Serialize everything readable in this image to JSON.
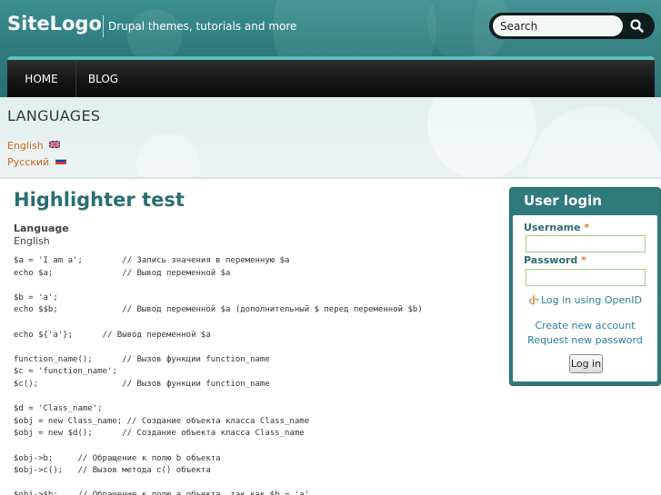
{
  "site": {
    "logo": "SiteLogo",
    "slogan": "Drupal themes, tutorials and more"
  },
  "search": {
    "placeholder": "Search",
    "icon": "search-icon"
  },
  "nav": {
    "items": [
      {
        "label": "HOME"
      },
      {
        "label": "BLOG"
      }
    ]
  },
  "languages": {
    "title": "LANGUAGES",
    "items": [
      {
        "label": "English",
        "flag": "uk-flag-icon"
      },
      {
        "label": "Русский",
        "flag": "ru-flag-icon"
      }
    ]
  },
  "content": {
    "title": "Highlighter test",
    "field_label": "Language",
    "field_value": "English",
    "code_lines": [
      "$a = 'I am a';        // Запись значения в переменную $a",
      "echo $a;              // Вывод переменной $a",
      "",
      "$b = 'a';",
      "echo $$b;             // Вывод переменной $a (дополнительный $ перед переменной $b)",
      "",
      "echo ${'a'};      // Вывод переменной $a",
      "",
      "function_name();      // Вызов функции function_name",
      "$c = 'function_name';",
      "$c();                 // Вызов функции function_name",
      "",
      "$d = 'Class_name';",
      "$obj = new Class_name; // Создание объекта класса Class_name",
      "$obj = new $d();      // Создание объекта класса Class_name",
      "",
      "$obj->b;     // Обращение к полю b объекта",
      "$obj->c();   // Вызов метода c() объекта",
      "",
      "$obj->$b;    // Обращение к полю a объекта, так как $b = 'a'"
    ]
  },
  "login": {
    "title": "User login",
    "username_label": "Username",
    "password_label": "Password",
    "required_mark": "*",
    "openid_label": "Log in using OpenID",
    "create_account": "Create new account",
    "request_password": "Request new password",
    "submit_label": "Log in"
  },
  "colors": {
    "accent": "#2a6e72",
    "link_orange": "#d8641a",
    "link_blue": "#2a7ea0",
    "nav_highlight": "#5cc0c2"
  }
}
